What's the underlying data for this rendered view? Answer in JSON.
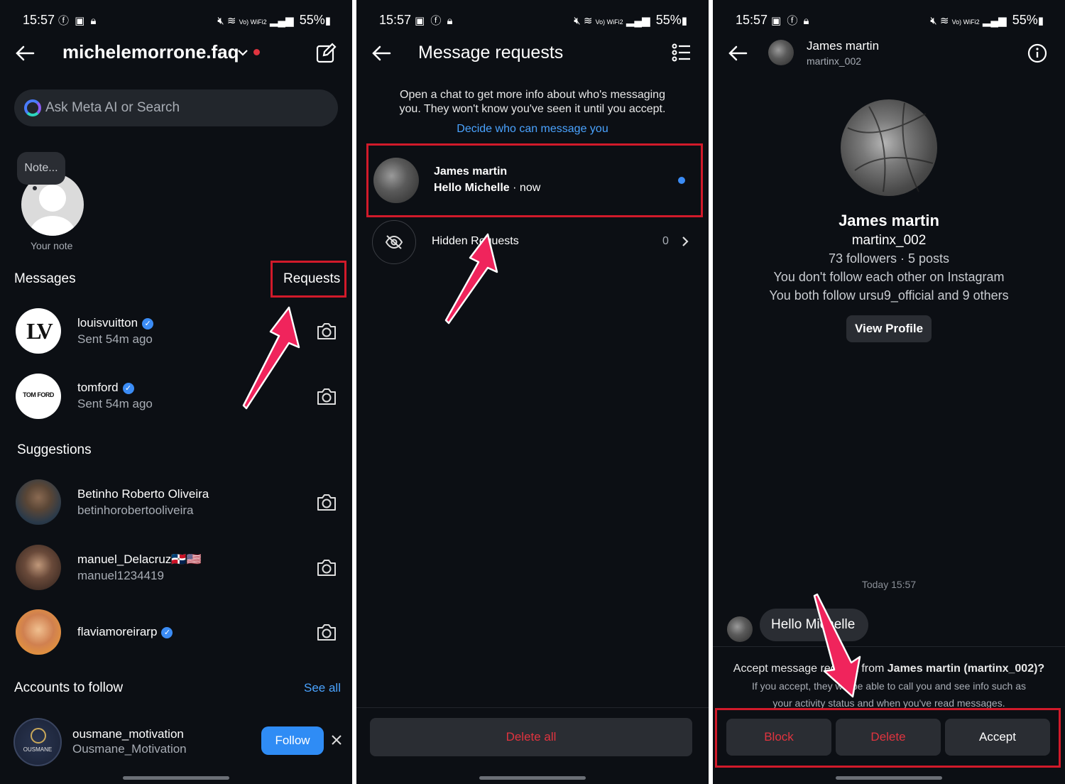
{
  "status_bar": {
    "time": "15:57",
    "battery": "55%",
    "carrier_tag": "Vo) WiFi2"
  },
  "panel1": {
    "title": "michelemorrone.faq",
    "search_placeholder": "Ask Meta AI or Search",
    "note_bubble": "Note...",
    "note_label": "Your note",
    "messages_heading": "Messages",
    "requests_label": "Requests",
    "messages": [
      {
        "name": "louisvuitton",
        "sub": "Sent 54m ago",
        "avatar_text": "LV"
      },
      {
        "name": "tomford",
        "sub": "Sent 54m ago",
        "avatar_text": "TOM FORD"
      }
    ],
    "suggestions_heading": "Suggestions",
    "suggestions": [
      {
        "name": "Betinho Roberto Oliveira",
        "sub": "betinhorobertooliveira"
      },
      {
        "name": "manuel_Delacruz🇩🇴🇺🇸",
        "sub": "manuel1234419"
      },
      {
        "name": "flaviamoreirarp",
        "sub": ""
      }
    ],
    "accounts_heading": "Accounts to follow",
    "see_all": "See all",
    "follow_account": {
      "name": "ousmane_motivation",
      "sub": "Ousmane_Motivation",
      "avatar_text": "OUSMANE"
    },
    "follow_button": "Follow"
  },
  "panel2": {
    "title": "Message requests",
    "info_line1": "Open a chat to get more info about who's messaging",
    "info_line2": "you. They won't know you've seen it until you accept.",
    "decide_link": "Decide who can message you",
    "request": {
      "name": "James martin",
      "preview": "Hello Michelle",
      "time": "now"
    },
    "hidden_label": "Hidden Requests",
    "hidden_count": "0",
    "delete_all": "Delete all"
  },
  "panel3": {
    "header_name": "James martin",
    "header_user": "martinx_002",
    "profile_name": "James martin",
    "profile_user": "martinx_002",
    "stats": "73 followers · 5 posts",
    "follow_info": "You don't follow each other on Instagram",
    "mutual": "You both follow ursu9_official and 9 others",
    "view_profile": "View Profile",
    "timestamp": "Today 15:57",
    "message": "Hello Michelle",
    "accept_prefix": "Accept message request from ",
    "accept_who": "James martin (martinx_002)?",
    "accept_info1": "If you accept, they will be able to call you and see info such as",
    "accept_info2": "your activity status and when you've read messages.",
    "block": "Block",
    "delete": "Delete",
    "accept": "Accept"
  },
  "colors": {
    "background": "#0c0f14",
    "accent_blue": "#3b8cf5",
    "link_blue": "#4aa3ff",
    "danger": "#e0343f",
    "highlight_red": "#d11a2a",
    "arrow_pink": "#f0245c"
  }
}
